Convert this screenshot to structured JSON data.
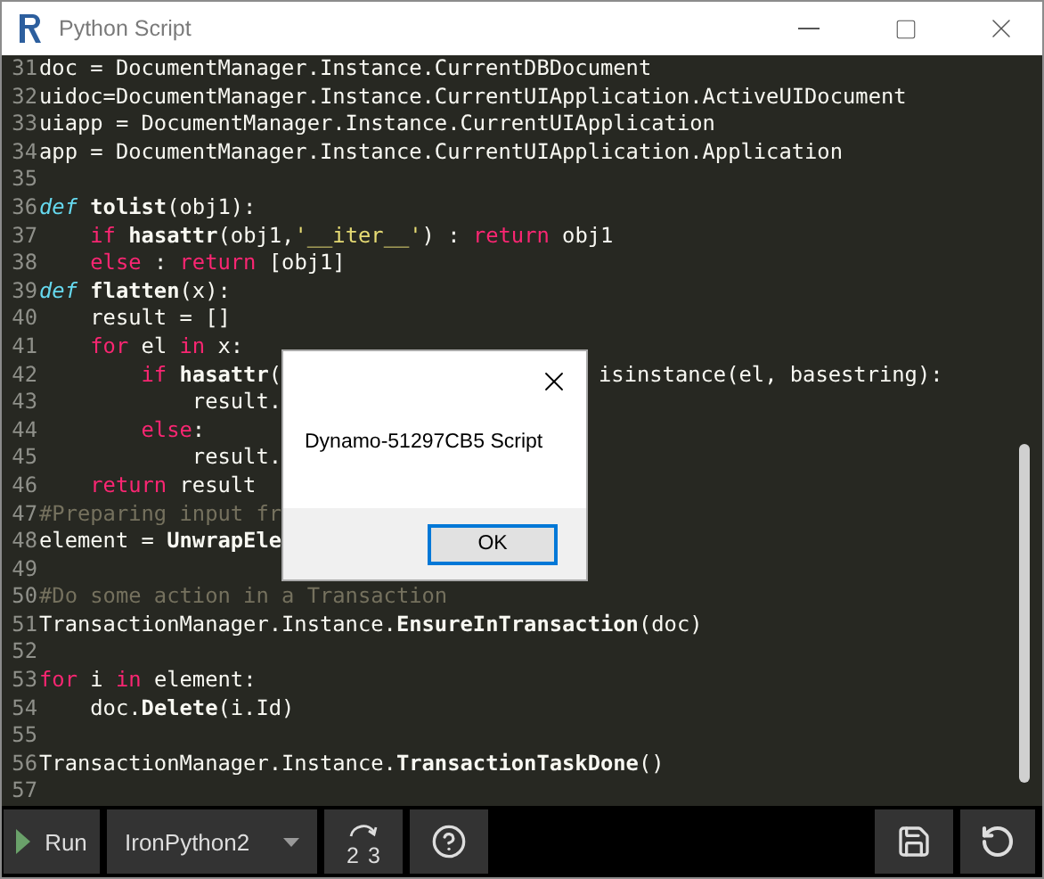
{
  "window": {
    "title": "Python Script"
  },
  "editor": {
    "lines": [
      {
        "number": "31",
        "segments": [
          [
            {
              "kind": "plain",
              "text": "doc = DocumentManager.Instance.CurrentDBDocument"
            }
          ]
        ]
      },
      {
        "number": "32",
        "segments": [
          [
            {
              "kind": "plain",
              "text": "uidoc=DocumentManager.Instance.CurrentUIApplication.ActiveUIDocument"
            }
          ]
        ]
      },
      {
        "number": "33",
        "segments": [
          [
            {
              "kind": "plain",
              "text": "uiapp = DocumentManager.Instance.CurrentUIApplication"
            }
          ]
        ]
      },
      {
        "number": "34",
        "segments": [
          [
            {
              "kind": "plain",
              "text": "app = DocumentManager.Instance.CurrentUIApplication.Application"
            }
          ]
        ]
      },
      {
        "number": "35"
      },
      {
        "number": "36",
        "segments": [
          [
            {
              "kind": "def",
              "text": "def "
            },
            {
              "kind": "name",
              "text": "tolist"
            },
            {
              "kind": "plain",
              "text": "(obj1):"
            }
          ]
        ]
      },
      {
        "number": "37",
        "segments": [
          [
            {
              "kind": "keyword",
              "text": "    if "
            },
            {
              "kind": "name",
              "text": "hasattr"
            },
            {
              "kind": "plain",
              "text": "(obj1,"
            },
            {
              "kind": "string",
              "text": "'__iter__'"
            },
            {
              "kind": "plain",
              "text": ") : "
            },
            {
              "kind": "keyword",
              "text": "return"
            },
            {
              "kind": "plain",
              "text": " obj1"
            }
          ]
        ]
      },
      {
        "number": "38",
        "segments": [
          [
            {
              "kind": "keyword",
              "text": "    else"
            },
            {
              "kind": "plain",
              "text": " : "
            },
            {
              "kind": "keyword",
              "text": "return"
            },
            {
              "kind": "plain",
              "text": " [obj1]"
            }
          ]
        ]
      },
      {
        "number": "39",
        "segments": [
          [
            {
              "kind": "def",
              "text": "def "
            },
            {
              "kind": "name",
              "text": "flatten"
            },
            {
              "kind": "plain",
              "text": "(x):"
            }
          ]
        ]
      },
      {
        "number": "40",
        "segments": [
          [
            {
              "kind": "plain",
              "text": "    result = []"
            }
          ]
        ]
      },
      {
        "number": "41",
        "segments": [
          [
            {
              "kind": "keyword",
              "text": "    for"
            },
            {
              "kind": "plain",
              "text": " el "
            },
            {
              "kind": "keyword",
              "text": "in"
            },
            {
              "kind": "plain",
              "text": " x:"
            }
          ]
        ]
      },
      {
        "number": "42",
        "segments": [
          [
            {
              "kind": "keyword",
              "text": "        if "
            },
            {
              "kind": "name",
              "text": "hasattr"
            },
            {
              "kind": "plain",
              "text": "("
            }
          ],
          [
            {
              "kind": "plain",
              "text": "isinstance(el, basestring):"
            }
          ]
        ]
      },
      {
        "number": "43",
        "segments": [
          [
            {
              "kind": "plain",
              "text": "            result."
            }
          ]
        ]
      },
      {
        "number": "44",
        "segments": [
          [
            {
              "kind": "keyword",
              "text": "        else"
            },
            {
              "kind": "plain",
              "text": ":"
            }
          ]
        ]
      },
      {
        "number": "45",
        "segments": [
          [
            {
              "kind": "plain",
              "text": "            result."
            }
          ]
        ]
      },
      {
        "number": "46",
        "segments": [
          [
            {
              "kind": "keyword",
              "text": "    return"
            },
            {
              "kind": "plain",
              "text": " result"
            }
          ]
        ]
      },
      {
        "number": "47",
        "segments": [
          [
            {
              "kind": "comment",
              "text": "#Preparing input fr"
            }
          ]
        ]
      },
      {
        "number": "48",
        "segments": [
          [
            {
              "kind": "plain",
              "text": "element = "
            },
            {
              "kind": "name",
              "text": "UnwrapEle"
            }
          ]
        ]
      },
      {
        "number": "49"
      },
      {
        "number": "50",
        "segments": [
          [
            {
              "kind": "comment",
              "text": "#Do some action in a Transaction"
            }
          ]
        ]
      },
      {
        "number": "51",
        "segments": [
          [
            {
              "kind": "plain",
              "text": "TransactionManager.Instance."
            },
            {
              "kind": "name",
              "text": "EnsureInTransaction"
            },
            {
              "kind": "plain",
              "text": "(doc)"
            }
          ]
        ]
      },
      {
        "number": "52"
      },
      {
        "number": "53",
        "segments": [
          [
            {
              "kind": "keyword",
              "text": "for"
            },
            {
              "kind": "plain",
              "text": " i "
            },
            {
              "kind": "keyword",
              "text": "in"
            },
            {
              "kind": "plain",
              "text": " element:"
            }
          ]
        ]
      },
      {
        "number": "54",
        "segments": [
          [
            {
              "kind": "plain",
              "text": "    doc."
            },
            {
              "kind": "name",
              "text": "Delete"
            },
            {
              "kind": "plain",
              "text": "(i.Id)"
            }
          ]
        ]
      },
      {
        "number": "55"
      },
      {
        "number": "56",
        "segments": [
          [
            {
              "kind": "plain",
              "text": "TransactionManager.Instance."
            },
            {
              "kind": "name",
              "text": "TransactionTaskDone"
            },
            {
              "kind": "plain",
              "text": "()"
            }
          ]
        ]
      },
      {
        "number": "57"
      }
    ]
  },
  "dialog": {
    "message": "Dynamo-51297CB5 Script",
    "buttons": [
      {
        "label": "OK",
        "default": true
      }
    ]
  },
  "toolbar": {
    "run_label": "Run",
    "engine": "IronPython2",
    "convert": {
      "from": "2",
      "to": "3"
    }
  }
}
